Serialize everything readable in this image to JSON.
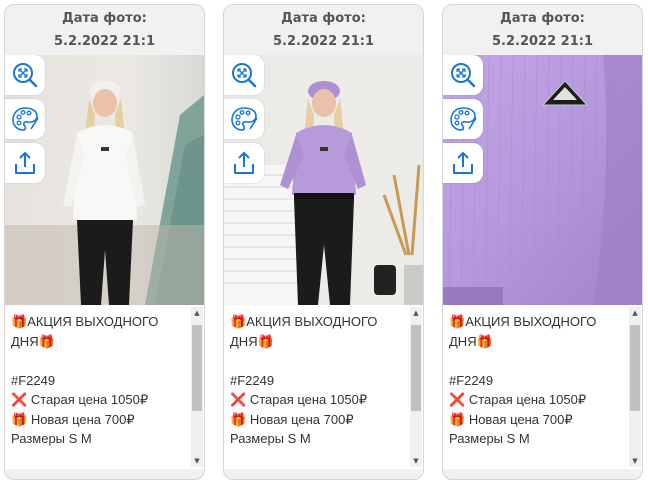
{
  "cards": [
    {
      "date_label": "Дата фото:",
      "date_value": "5.2.2022 21:1",
      "promo_line1": "АКЦИЯ ВЫХОДНОГО",
      "promo_line2": "ДНЯ",
      "sku": "#F2249",
      "old_price": "Старая цена 1050₽",
      "new_price": "Новая цена 700₽",
      "sizes": "Размеры S M",
      "photo": "woman-white-sweater"
    },
    {
      "date_label": "Дата фото:",
      "date_value": "5.2.2022 21:1",
      "promo_line1": "АКЦИЯ ВЫХОДНОГО",
      "promo_line2": "ДНЯ",
      "sku": "#F2249",
      "old_price": "Старая цена 1050₽",
      "new_price": "Новая цена 700₽",
      "sizes": "Размеры S M",
      "photo": "woman-lilac-sweater"
    },
    {
      "date_label": "Дата фото:",
      "date_value": "5.2.2022 21:1",
      "promo_line1": "АКЦИЯ ВЫХОДНОГО",
      "promo_line2": "ДНЯ",
      "sku": "#F2249",
      "old_price": "Старая цена 1050₽",
      "new_price": "Новая цена 700₽",
      "sizes": "Размеры S M",
      "photo": "lilac-sweater-closeup"
    }
  ],
  "icons": {
    "zoom": "zoom-icon",
    "palette": "palette-icon",
    "share": "share-icon",
    "gift": "gift-emoji",
    "cross": "cross-mark-emoji"
  },
  "colors": {
    "icon_blue": "#1976d2",
    "header_text": "#555555",
    "cross_red": "#d9312a",
    "lilac": "#b79ad9"
  }
}
